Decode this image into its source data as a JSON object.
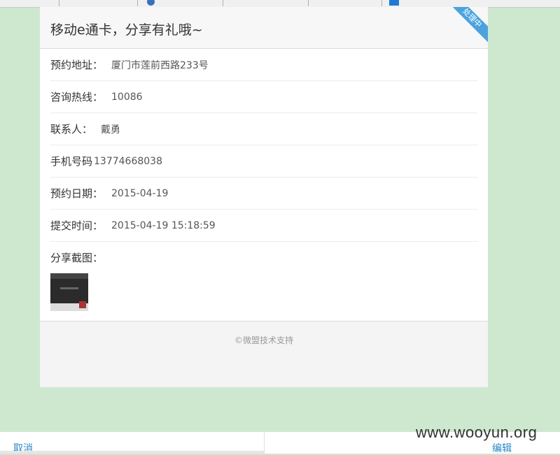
{
  "card": {
    "title": "移动e通卡，分享有礼哦~",
    "status_badge": "处理中",
    "rows": [
      {
        "label": "预约地址：",
        "value": "厦门市莲前西路233号"
      },
      {
        "label": "咨询热线：",
        "value": "10086"
      },
      {
        "label": "联系人：",
        "value": "戴勇"
      },
      {
        "label": "手机号码",
        "value": "13774668038"
      },
      {
        "label": "预约日期：",
        "value": "2015-04-19"
      },
      {
        "label": "提交时间：",
        "value": "2015-04-19 15:18:59"
      }
    ],
    "share_label": "分享截图：",
    "footer": "©微盟技术支持"
  },
  "bottom_bar": {
    "cancel": "取消",
    "edit": "编辑"
  },
  "watermark": "www.wooyun.org",
  "colors": {
    "page_bg": "#cde8cf",
    "badge": "#4aa3df",
    "link": "#2a86c8"
  }
}
